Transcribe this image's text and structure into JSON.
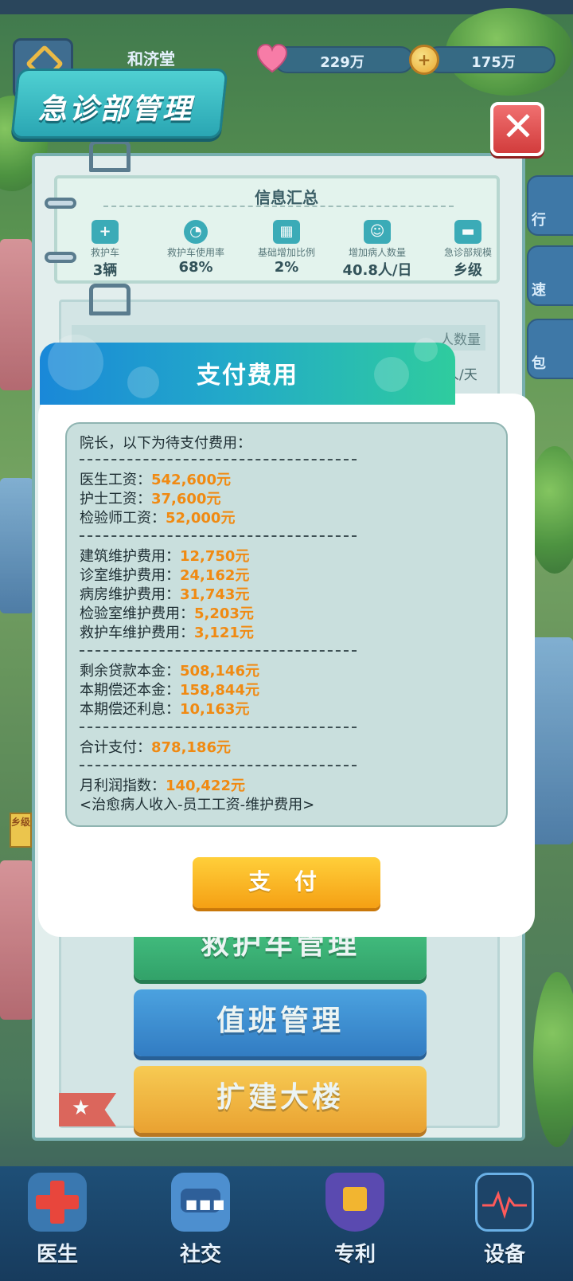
{
  "topbar": {
    "hospital_name": "和济堂",
    "hearts": "229万",
    "coins": "175万"
  },
  "header": {
    "title": "急诊部管理"
  },
  "side_tabs": [
    "行",
    "速",
    "包"
  ],
  "info_summary": {
    "title": "信息汇总",
    "stats": [
      {
        "label": "救护车",
        "value": "3辆",
        "icon": "ambulance-icon"
      },
      {
        "label": "救护车使用率",
        "value": "68%",
        "icon": "pie-chart-icon"
      },
      {
        "label": "基础增加比例",
        "value": "2%",
        "icon": "calendar-icon"
      },
      {
        "label": "增加病人数量",
        "value": "40.8人/日",
        "icon": "patients-icon"
      },
      {
        "label": "急诊部规模",
        "value": "乡级",
        "icon": "bed-icon"
      }
    ]
  },
  "table_header_fragment": "人数量",
  "row_fragments": [
    "人/天",
    "人/天"
  ],
  "modal": {
    "title": "支付费用",
    "intro": "院长，以下为待支付费用：",
    "separator": "--------------------------------",
    "salaries": [
      {
        "label": "医生工资：",
        "amount": "542,600元"
      },
      {
        "label": "护士工资：",
        "amount": "37,600元"
      },
      {
        "label": "检验师工资：",
        "amount": "52,000元"
      }
    ],
    "maintenance": [
      {
        "label": "建筑维护费用：",
        "amount": "12,750元"
      },
      {
        "label": "诊室维护费用：",
        "amount": "24,162元"
      },
      {
        "label": "病房维护费用：",
        "amount": "31,743元"
      },
      {
        "label": "检验室维护费用：",
        "amount": "5,203元"
      },
      {
        "label": "救护车维护费用：",
        "amount": "3,121元"
      }
    ],
    "loan": [
      {
        "label": "剩余贷款本金：",
        "amount": "508,146元"
      },
      {
        "label": "本期偿还本金：",
        "amount": "158,844元"
      },
      {
        "label": "本期偿还利息：",
        "amount": "10,163元"
      }
    ],
    "total": {
      "label": "合计支付：",
      "amount": "878,186元"
    },
    "profit": {
      "label": "月利润指数：",
      "amount": "140,422元"
    },
    "formula": "<治愈病人收入-员工工资-维护费用>",
    "pay_label": "支 付"
  },
  "management_buttons": {
    "ambulance": "救护车管理",
    "duty": "值班管理",
    "expand": "扩建大楼"
  },
  "side_badge": "乡级",
  "bottom_nav": [
    {
      "label": "医生",
      "icon": "doctor-cross-icon"
    },
    {
      "label": "社交",
      "icon": "chat-icon"
    },
    {
      "label": "专利",
      "icon": "patent-shield-icon"
    },
    {
      "label": "设备",
      "icon": "monitor-icon"
    }
  ],
  "colors": {
    "amount": "#f08a12",
    "header_gradient_start": "#1a88d8",
    "header_gradient_end": "#2fcc9e",
    "pay_button": "#f5a014"
  }
}
